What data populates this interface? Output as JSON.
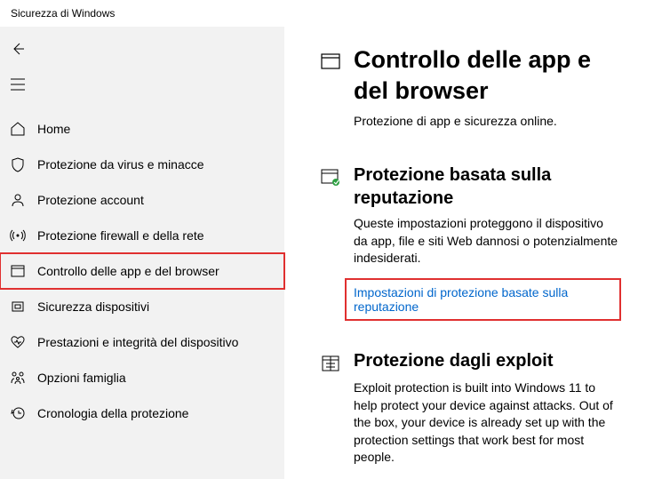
{
  "window": {
    "title": "Sicurezza di Windows"
  },
  "sidebar": {
    "items": [
      {
        "label": "Home"
      },
      {
        "label": "Protezione da virus e minacce"
      },
      {
        "label": "Protezione account"
      },
      {
        "label": "Protezione firewall e della rete"
      },
      {
        "label": "Controllo delle app e del browser"
      },
      {
        "label": "Sicurezza dispositivi"
      },
      {
        "label": "Prestazioni e integrità del dispositivo"
      },
      {
        "label": "Opzioni famiglia"
      },
      {
        "label": "Cronologia della protezione"
      }
    ]
  },
  "main": {
    "title": "Controllo delle app e del browser",
    "subtitle": "Protezione di app e sicurezza online.",
    "reputation": {
      "heading": "Protezione basata sulla reputazione",
      "desc": "Queste impostazioni proteggono il dispositivo da app, file e siti Web dannosi o potenzialmente indesiderati.",
      "link": "Impostazioni di protezione basate sulla reputazione"
    },
    "exploit": {
      "heading": "Protezione dagli exploit",
      "desc": "Exploit protection is built into Windows 11 to help protect your device against attacks.  Out of the box, your device is already set up with the protection settings that work best for most people."
    }
  }
}
